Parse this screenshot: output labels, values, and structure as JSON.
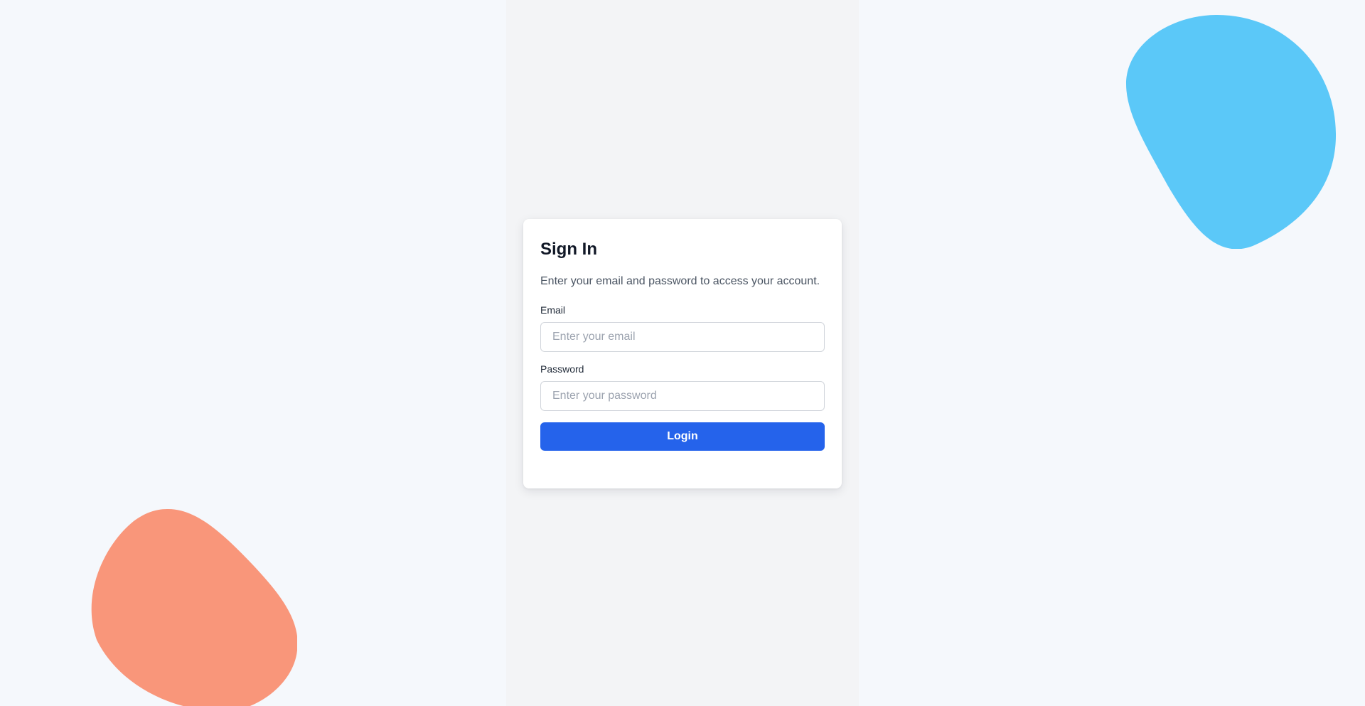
{
  "colors": {
    "page_background": "#f5f8fc",
    "center_column": "#f3f4f6",
    "card_background": "#ffffff",
    "primary_button": "#2563eb",
    "blob_blue": "#5bc8f8",
    "blob_orange": "#f9967a"
  },
  "decorations": {
    "top_right": "blue-blob",
    "bottom_left": "orange-blob"
  },
  "sign_in": {
    "title": "Sign In",
    "subtitle": "Enter your email and password to access your account.",
    "email": {
      "label": "Email",
      "value": "",
      "placeholder": "Enter your email"
    },
    "password": {
      "label": "Password",
      "value": "",
      "placeholder": "Enter your password"
    },
    "submit_label": "Login"
  }
}
